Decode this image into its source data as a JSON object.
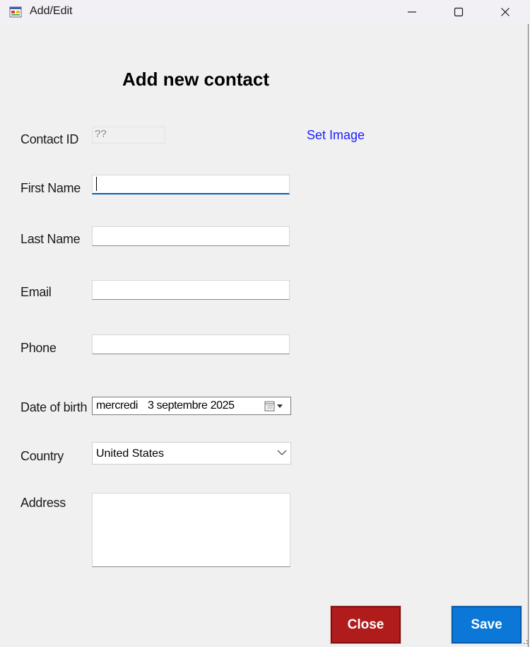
{
  "window": {
    "title": "Add/Edit",
    "icons": [
      "app-icon",
      "minimize-icon",
      "maximize-icon",
      "close-icon"
    ]
  },
  "form": {
    "heading": "Add new contact",
    "contact_id": {
      "label": "Contact ID",
      "value": "??"
    },
    "set_image_link": "Set Image",
    "first_name": {
      "label": "First Name",
      "value": ""
    },
    "last_name": {
      "label": "Last Name",
      "value": ""
    },
    "email": {
      "label": "Email",
      "value": ""
    },
    "phone": {
      "label": "Phone",
      "value": ""
    },
    "date_of_birth": {
      "label": "Date of birth",
      "weekday": "mercredi",
      "date": "3 septembre 2025"
    },
    "country": {
      "label": "Country",
      "value": "United States"
    },
    "address": {
      "label": "Address",
      "value": ""
    }
  },
  "buttons": {
    "close_label": "Close",
    "save_label": "Save"
  },
  "colors": {
    "close_button": "#b01c1c",
    "save_button": "#0b78d7",
    "link": "#1d1dff",
    "focus_accent": "#005fb8"
  }
}
